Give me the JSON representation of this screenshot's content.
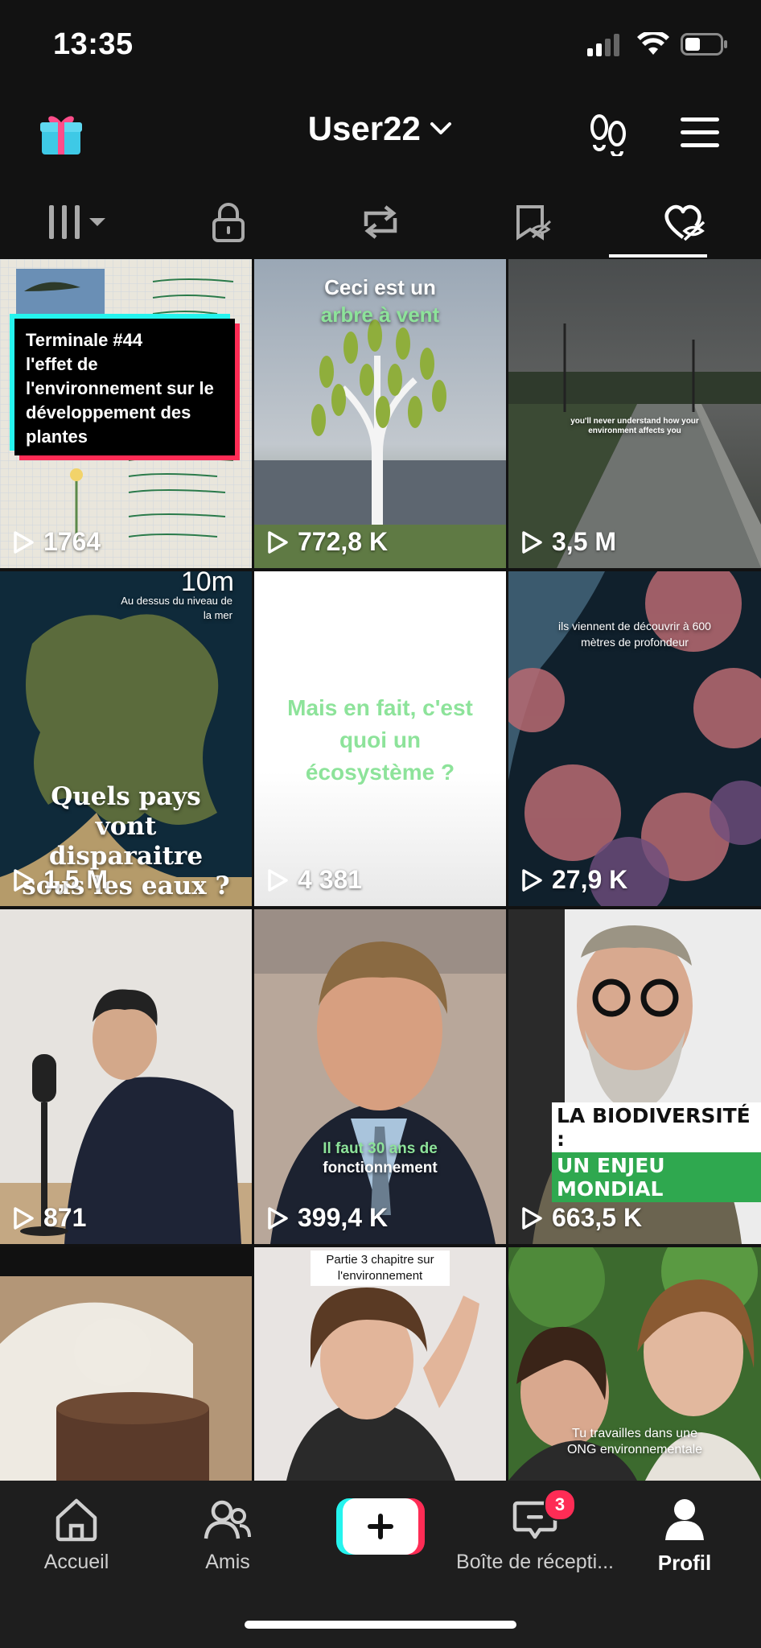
{
  "status": {
    "time": "13:35"
  },
  "header": {
    "username": "User22"
  },
  "tabs": [
    {
      "icon": "grid-icon"
    },
    {
      "icon": "lock-icon"
    },
    {
      "icon": "repost-icon"
    },
    {
      "icon": "bookmark-hidden-icon"
    },
    {
      "icon": "liked-hidden-icon"
    }
  ],
  "videos": [
    {
      "views": "1764",
      "overlay": [
        "Terminale #44",
        "l'effet de",
        "l'environnement sur le",
        "développement des",
        "plantes"
      ]
    },
    {
      "views": "772,8 K",
      "caption_line1": "Ceci est un",
      "caption_line2": "arbre à vent"
    },
    {
      "views": "3,5 M",
      "caption": "you'll never understand how your environment affects you"
    },
    {
      "views": "1,5 M",
      "top_small": "10m",
      "top_caption": "Au dessus du niveau de la mer",
      "caption": "Quels pays vont disparaitre sous les eaux  ?"
    },
    {
      "views": "4 381",
      "caption": "Mais en fait, c'est quoi un écosystème ?"
    },
    {
      "views": "27,9 K",
      "caption": "ils viennent de découvrir à 600 mètres de profondeur"
    },
    {
      "views": "871"
    },
    {
      "views": "399,4 K",
      "caption_line1": "Il faut 30 ans de",
      "caption_line2": "fonctionnement"
    },
    {
      "views": "663,5 K",
      "caption_line1": "LA BIODIVERSITÉ :",
      "caption_line2": "UN ENJEU MONDIAL"
    },
    {
      "views": ""
    },
    {
      "views": "",
      "caption": "Partie 3 chapitre sur l'environnement"
    },
    {
      "views": "",
      "caption": "Tu travailles dans une ONG environnementale"
    }
  ],
  "nav": {
    "home": "Accueil",
    "friends": "Amis",
    "inbox": "Boîte de récepti...",
    "inbox_badge": "3",
    "profile": "Profil"
  },
  "colors": {
    "accent_red": "#fe2c55",
    "accent_cyan": "#25f4ee",
    "green_text": "#8de39a"
  }
}
